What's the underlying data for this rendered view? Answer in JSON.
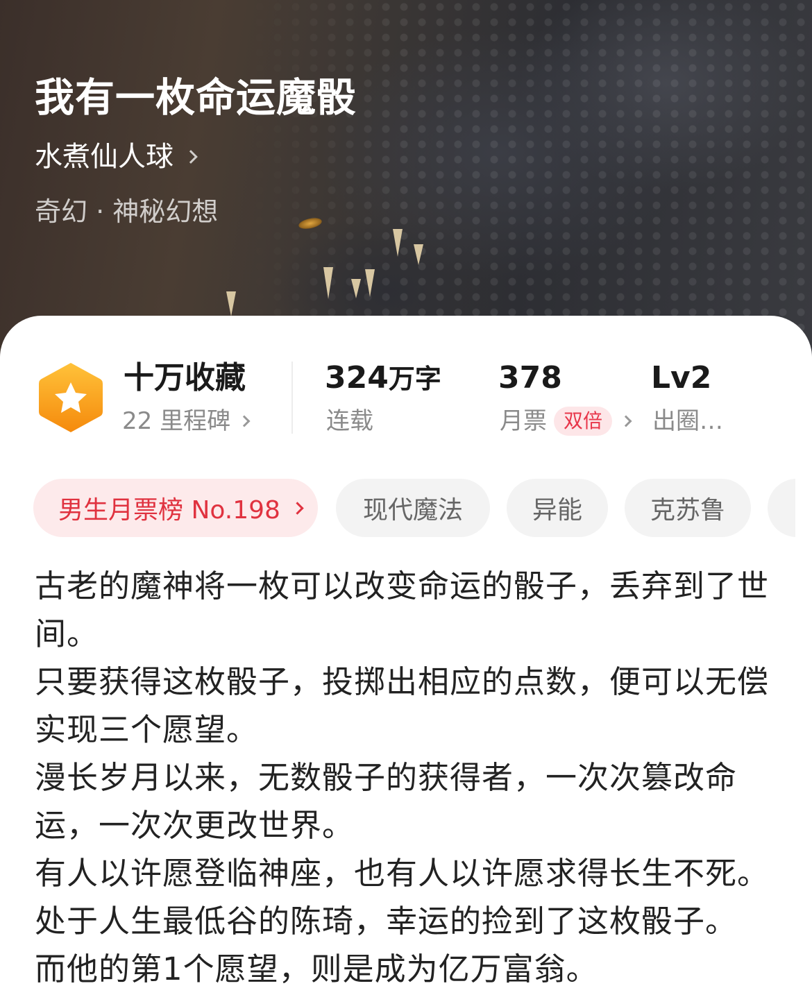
{
  "book": {
    "title": "我有一枚命运魔骰",
    "author": "水煮仙人球",
    "genre": "奇幻 · 神秘幻想"
  },
  "stats": {
    "favorites": {
      "main": "十万收藏",
      "sub": "22 里程碑",
      "badge_icon": "star-icon"
    },
    "words": {
      "number": "324",
      "unit": "万字",
      "sub": "连载"
    },
    "monthly": {
      "number": "378",
      "sub": "月票",
      "badge": "双倍"
    },
    "level": {
      "main": "Lv2",
      "sub": "出圈…"
    }
  },
  "tags": [
    {
      "label": "男生月票榜 No.198",
      "kind": "rank"
    },
    {
      "label": "现代魔法",
      "kind": "tag"
    },
    {
      "label": "异能",
      "kind": "tag"
    },
    {
      "label": "克苏鲁",
      "kind": "tag"
    }
  ],
  "description": [
    "古老的魔神将一枚可以改变命运的骰子，丢弃到了世间。",
    "只要获得这枚骰子，投掷出相应的点数，便可以无偿实现三个愿望。",
    "漫长岁月以来，无数骰子的获得者，一次次篡改命运，一次次更改世界。",
    "有人以许愿登临神座，也有人以许愿求得长生不死。",
    "处于人生最低谷的陈琦，幸运的捡到了这枚骰子。",
    "而他的第1个愿望，则是成为亿万富翁。"
  ],
  "colors": {
    "accent_red": "#e0323f",
    "badge_orange": "#f7a21b",
    "rank_bg": "#fdeaeb",
    "tag_bg": "#f3f3f3"
  }
}
